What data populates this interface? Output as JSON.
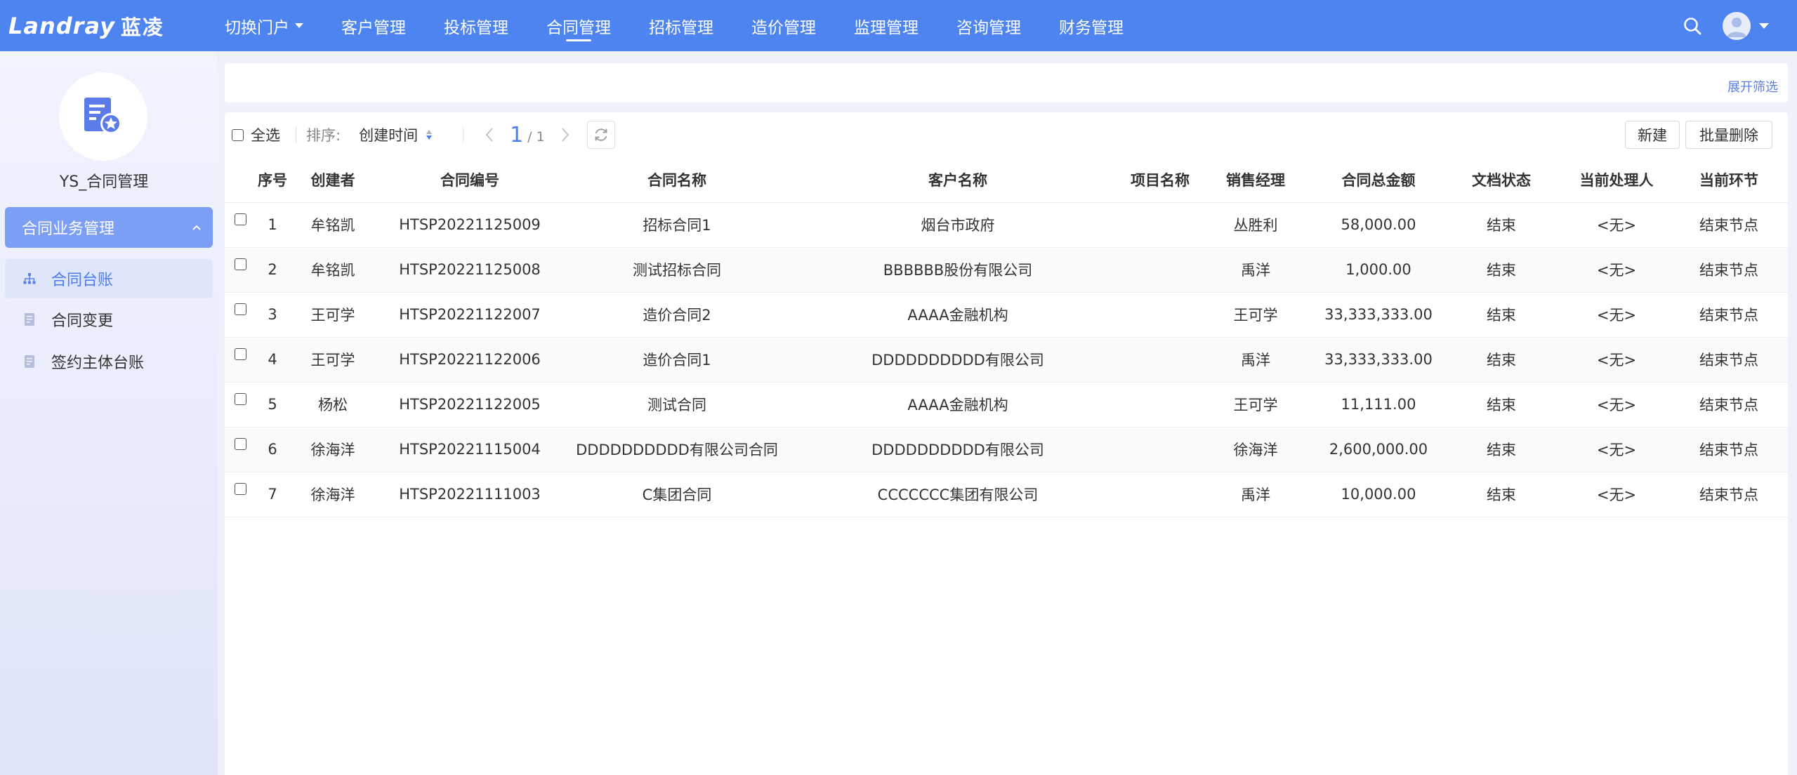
{
  "header": {
    "brand": "Landray",
    "brand_cn": "蓝凌",
    "nav": [
      {
        "label": "切换门户",
        "dropdown": true
      },
      {
        "label": "客户管理"
      },
      {
        "label": "投标管理"
      },
      {
        "label": "合同管理",
        "active": true
      },
      {
        "label": "招标管理"
      },
      {
        "label": "造价管理"
      },
      {
        "label": "监理管理"
      },
      {
        "label": "咨询管理"
      },
      {
        "label": "财务管理"
      }
    ],
    "icons": [
      "search-icon",
      "avatar",
      "chevron-down-icon"
    ]
  },
  "sidebar": {
    "module_title": "YS_合同管理",
    "module_icon": "contract-badge-icon",
    "group": {
      "label": "合同业务管理",
      "expanded": true
    },
    "items": [
      {
        "label": "合同台账",
        "icon": "org-tree-icon",
        "active": true
      },
      {
        "label": "合同变更",
        "icon": "document-icon"
      },
      {
        "label": "签约主体台账",
        "icon": "document-icon"
      }
    ]
  },
  "filter": {
    "expand_label": "展开筛选"
  },
  "toolbar": {
    "select_all": "全选",
    "sort_label": "排序:",
    "sort_field": "创建时间",
    "page_current": "1",
    "page_total": "/ 1",
    "new_button": "新建",
    "batch_delete_button": "批量删除"
  },
  "table": {
    "columns": [
      "序号",
      "创建者",
      "合同编号",
      "合同名称",
      "客户名称",
      "项目名称",
      "销售经理",
      "合同总金额",
      "文档状态",
      "当前处理人",
      "当前环节"
    ],
    "rows": [
      [
        "1",
        "牟铭凯",
        "HTSP20221125009",
        "招标合同1",
        "烟台市政府",
        "",
        "丛胜利",
        "58,000.00",
        "结束",
        "<无>",
        "结束节点"
      ],
      [
        "2",
        "牟铭凯",
        "HTSP20221125008",
        "测试招标合同",
        "BBBBBB股份有限公司",
        "",
        "禹洋",
        "1,000.00",
        "结束",
        "<无>",
        "结束节点"
      ],
      [
        "3",
        "王可学",
        "HTSP20221122007",
        "造价合同2",
        "AAAA金融机构",
        "",
        "王可学",
        "33,333,333.00",
        "结束",
        "<无>",
        "结束节点"
      ],
      [
        "4",
        "王可学",
        "HTSP20221122006",
        "造价合同1",
        "DDDDDDDDDD有限公司",
        "",
        "禹洋",
        "33,333,333.00",
        "结束",
        "<无>",
        "结束节点"
      ],
      [
        "5",
        "杨松",
        "HTSP20221122005",
        "测试合同",
        "AAAA金融机构",
        "",
        "王可学",
        "11,111.00",
        "结束",
        "<无>",
        "结束节点"
      ],
      [
        "6",
        "徐海洋",
        "HTSP20221115004",
        "DDDDDDDDDD有限公司合同",
        "DDDDDDDDDD有限公司",
        "",
        "徐海洋",
        "2,600,000.00",
        "结束",
        "<无>",
        "结束节点"
      ],
      [
        "7",
        "徐海洋",
        "HTSP20221111003",
        "C集团合同",
        "CCCCCCC集团有限公司",
        "",
        "禹洋",
        "10,000.00",
        "结束",
        "<无>",
        "结束节点"
      ]
    ]
  },
  "colors": {
    "topbar": "#4d84f0",
    "accent": "#4d7cf0",
    "sidebar_group": "#7c9ef5",
    "sidebar_active_bg": "#dfe6fc"
  }
}
